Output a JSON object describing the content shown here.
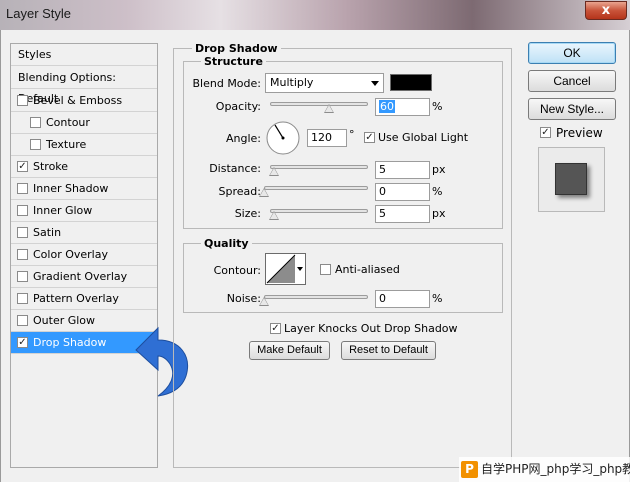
{
  "window": {
    "title": "Layer Style",
    "close_glyph": "x"
  },
  "styles_list": {
    "header": "Styles",
    "blending_options": "Blending Options: Default",
    "items": [
      {
        "label": "Bevel & Emboss",
        "checked": false,
        "indent": false
      },
      {
        "label": "Contour",
        "checked": false,
        "indent": true
      },
      {
        "label": "Texture",
        "checked": false,
        "indent": true
      },
      {
        "label": "Stroke",
        "checked": true,
        "indent": false
      },
      {
        "label": "Inner Shadow",
        "checked": false,
        "indent": false
      },
      {
        "label": "Inner Glow",
        "checked": false,
        "indent": false
      },
      {
        "label": "Satin",
        "checked": false,
        "indent": false
      },
      {
        "label": "Color Overlay",
        "checked": false,
        "indent": false
      },
      {
        "label": "Gradient Overlay",
        "checked": false,
        "indent": false
      },
      {
        "label": "Pattern Overlay",
        "checked": false,
        "indent": false
      },
      {
        "label": "Outer Glow",
        "checked": false,
        "indent": false
      },
      {
        "label": "Drop Shadow",
        "checked": true,
        "indent": false,
        "selected": true
      }
    ]
  },
  "drop_shadow": {
    "title": "Drop Shadow",
    "structure": {
      "title": "Structure",
      "blend_mode_label": "Blend Mode:",
      "blend_mode_value": "Multiply",
      "shadow_color": "#000000",
      "opacity_label": "Opacity:",
      "opacity_value": "60",
      "opacity_unit": "%",
      "opacity_level": 0.6,
      "angle_label": "Angle:",
      "angle_value": "120",
      "angle_unit": "°",
      "use_global_light_label": "Use Global Light",
      "use_global_light_checked": true,
      "distance_label": "Distance:",
      "distance_value": "5",
      "distance_unit": "px",
      "distance_level": 0.04,
      "spread_label": "Spread:",
      "spread_value": "0",
      "spread_unit": "%",
      "spread_level": 0.0,
      "size_label": "Size:",
      "size_value": "5",
      "size_unit": "px",
      "size_level": 0.04
    },
    "quality": {
      "title": "Quality",
      "contour_label": "Contour:",
      "anti_aliased_label": "Anti-aliased",
      "anti_aliased_checked": false,
      "noise_label": "Noise:",
      "noise_value": "0",
      "noise_unit": "%",
      "noise_level": 0.0
    },
    "layer_knocks_out_label": "Layer Knocks Out Drop Shadow",
    "layer_knocks_out_checked": true,
    "make_default_label": "Make Default",
    "reset_default_label": "Reset to Default"
  },
  "actions": {
    "ok_label": "OK",
    "cancel_label": "Cancel",
    "new_style_label": "New Style...",
    "preview_label": "Preview",
    "preview_checked": true
  },
  "watermark": {
    "logo": "P",
    "text": "自学PHP网_php学习_php教"
  },
  "colors": {
    "selection": "#3399ff",
    "arrow": "#2f6fd4",
    "preview_square": "#555555"
  }
}
